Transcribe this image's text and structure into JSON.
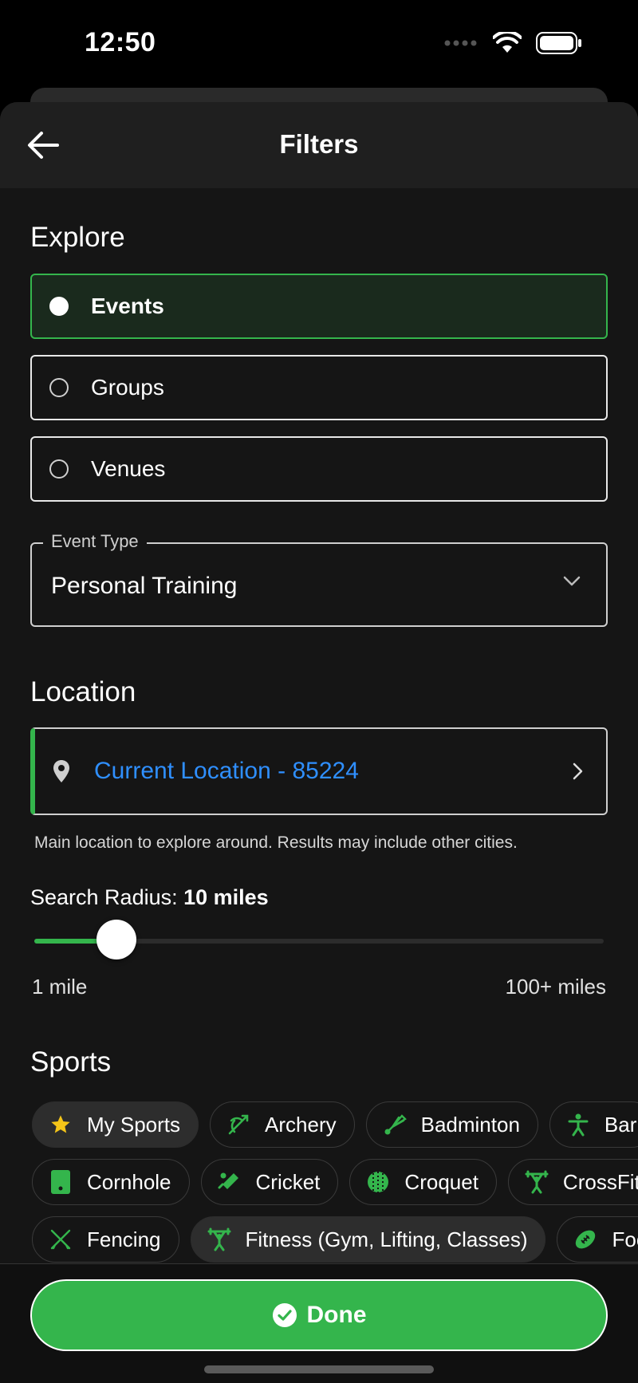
{
  "status_bar": {
    "time": "12:50"
  },
  "header": {
    "title": "Filters"
  },
  "explore": {
    "title": "Explore",
    "options": [
      {
        "label": "Events",
        "selected": true
      },
      {
        "label": "Groups",
        "selected": false
      },
      {
        "label": "Venues",
        "selected": false
      }
    ]
  },
  "event_type": {
    "label": "Event Type",
    "value": "Personal Training"
  },
  "location": {
    "title": "Location",
    "value": "Current Location - 85224",
    "helper": "Main location to explore around. Results may include other cities."
  },
  "radius": {
    "label": "Search Radius:",
    "value": "10 miles",
    "fraction": 0.1,
    "min_label": "1 mile",
    "max_label": "100+ miles"
  },
  "sports": {
    "title": "Sports",
    "rows": [
      [
        {
          "label": "My Sports",
          "icon": "star-icon",
          "active": true
        },
        {
          "label": "Archery",
          "icon": "archery-icon",
          "active": false
        },
        {
          "label": "Badminton",
          "icon": "shuttlecock-icon",
          "active": false
        },
        {
          "label": "Bar",
          "icon": "person-icon",
          "active": false
        }
      ],
      [
        {
          "label": "Cornhole",
          "icon": "cornhole-board-icon",
          "active": false
        },
        {
          "label": "Cricket",
          "icon": "cricket-icon",
          "active": false
        },
        {
          "label": "Croquet",
          "icon": "croquet-ball-icon",
          "active": false
        },
        {
          "label": "CrossFit",
          "icon": "weightlifter-icon",
          "active": false
        }
      ],
      [
        {
          "label": "Fencing",
          "icon": "fencing-icon",
          "active": false
        },
        {
          "label": "Fitness (Gym, Lifting, Classes)",
          "icon": "weightlifter-icon",
          "active": true
        },
        {
          "label": "Foot",
          "icon": "football-icon",
          "active": false
        }
      ]
    ]
  },
  "done_button": {
    "label": "Done"
  },
  "colors": {
    "accent": "#34b54c",
    "link": "#2f8fff",
    "background": "#151515"
  }
}
